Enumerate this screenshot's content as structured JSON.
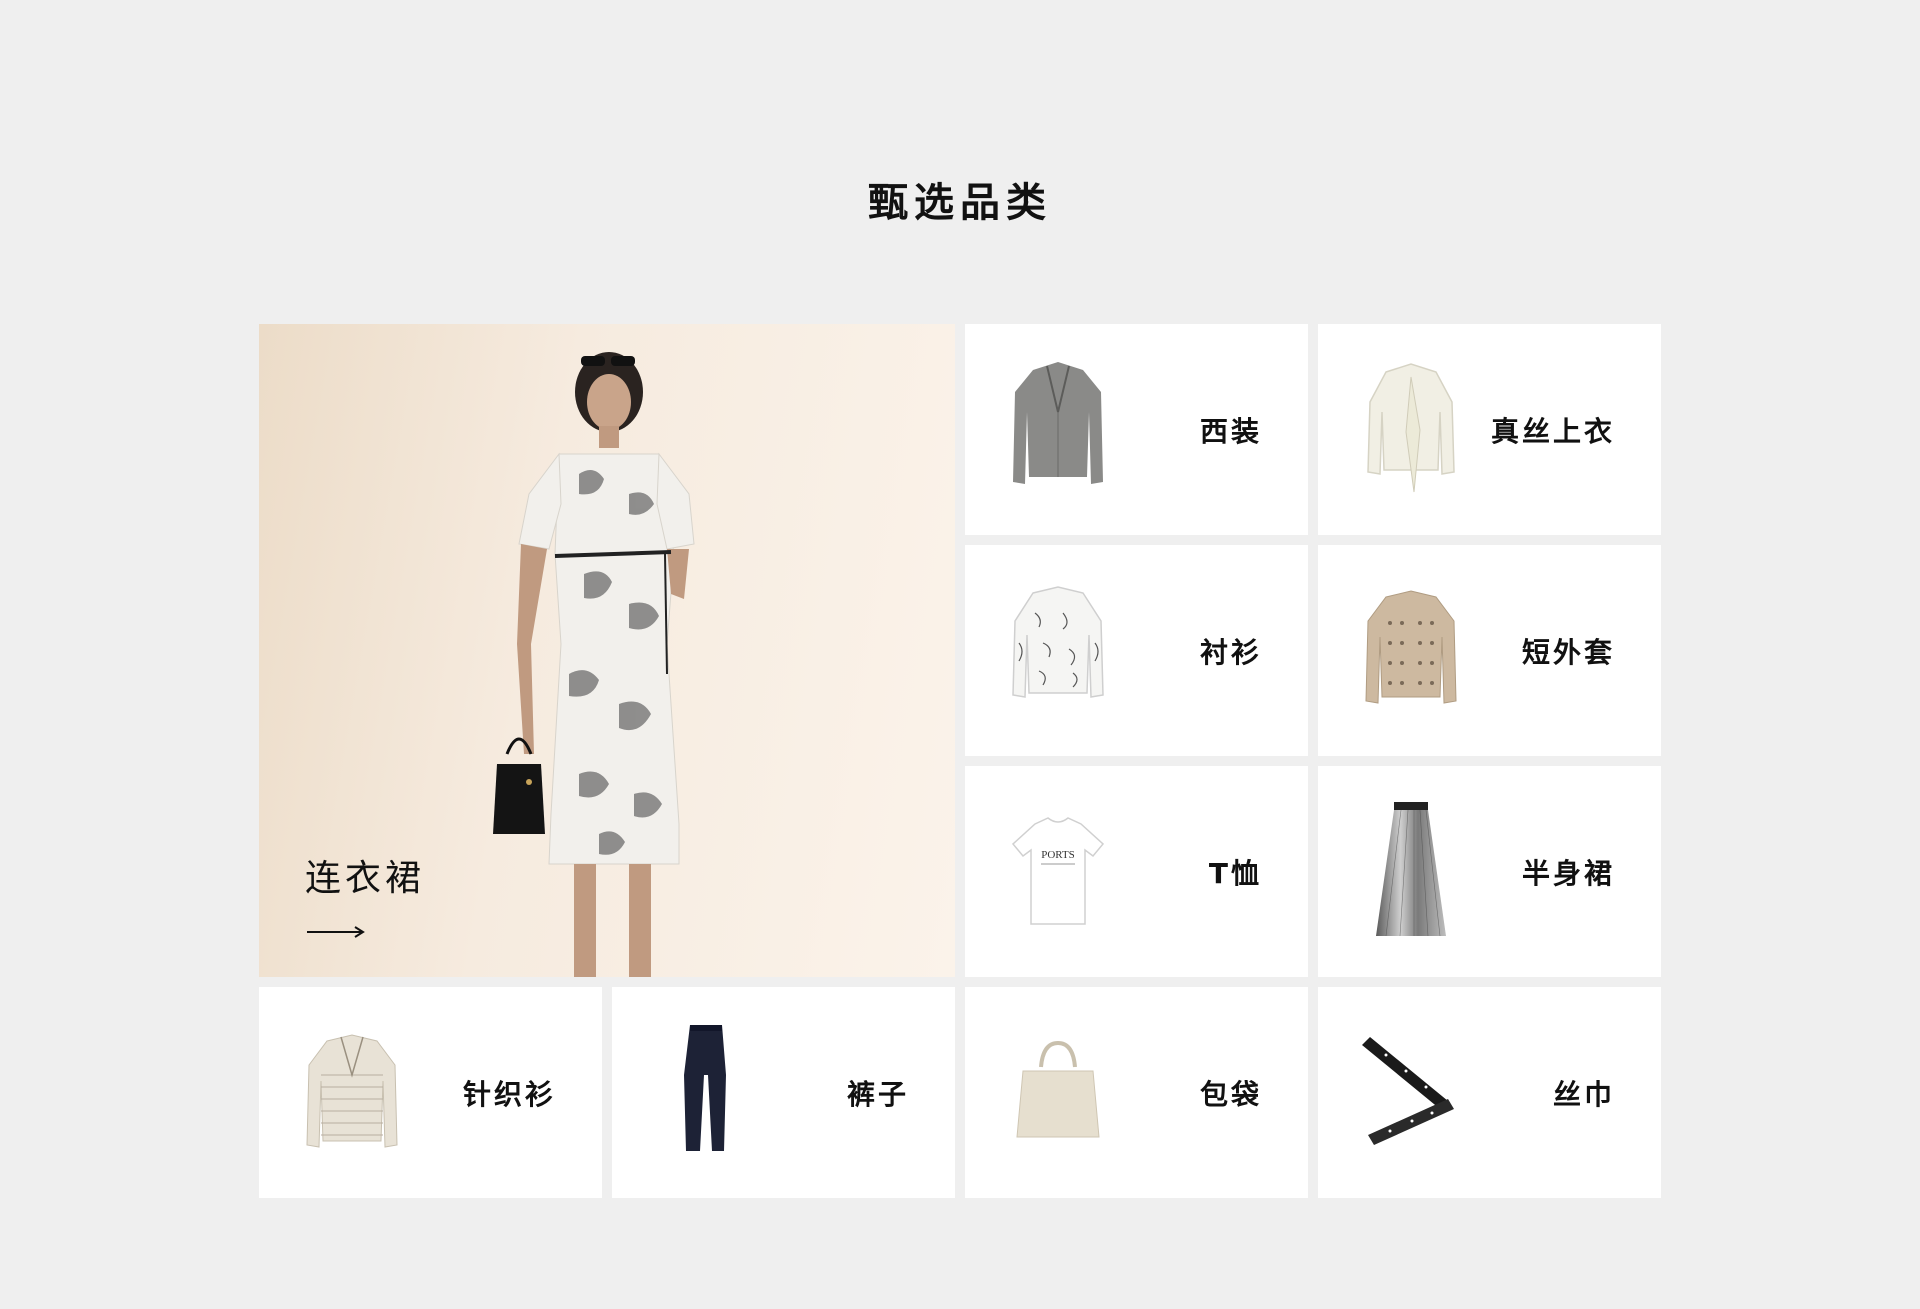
{
  "section": {
    "title": "甄选品类"
  },
  "feature": {
    "label": "连衣裙",
    "arrow": "arrow-right-icon"
  },
  "categories": [
    {
      "label": "西装",
      "icon": "blazer-icon"
    },
    {
      "label": "真丝上衣",
      "icon": "silk-blouse-icon"
    },
    {
      "label": "衬衫",
      "icon": "shirt-icon"
    },
    {
      "label": "短外套",
      "icon": "short-jacket-icon"
    },
    {
      "label": "T恤",
      "icon": "tshirt-icon"
    },
    {
      "label": "半身裙",
      "icon": "skirt-icon"
    },
    {
      "label": "针织衫",
      "icon": "knit-cardigan-icon"
    },
    {
      "label": "裤子",
      "icon": "trousers-icon"
    },
    {
      "label": "包袋",
      "icon": "handbag-icon"
    },
    {
      "label": "丝巾",
      "icon": "silk-scarf-icon"
    }
  ],
  "tshirt_print": "PORTS",
  "colors": {
    "background": "#efefef",
    "card": "#ffffff",
    "text": "#111111",
    "feature_bg": "#f6ebdf"
  }
}
